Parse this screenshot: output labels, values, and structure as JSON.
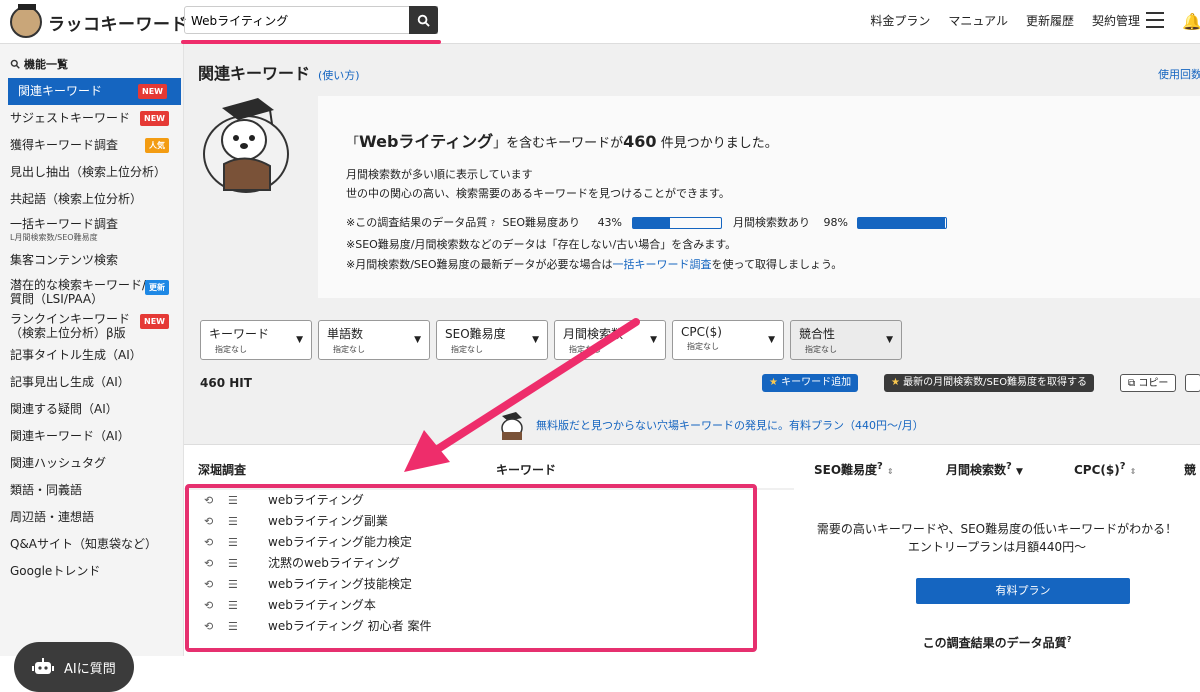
{
  "app": {
    "logo_text": "ラッコキーワード"
  },
  "search": {
    "value": "Webライティング"
  },
  "topnav": [
    "料金プラン",
    "マニュアル",
    "更新履歴",
    "契約管理"
  ],
  "sidebar": {
    "heading": "機能一覧",
    "items": [
      {
        "label": "関連キーワード",
        "badge": "NEW",
        "badge_type": "new",
        "active": true
      },
      {
        "label": "サジェストキーワード",
        "badge": "NEW",
        "badge_type": "new"
      },
      {
        "label": "獲得キーワード調査",
        "badge": "人気",
        "badge_type": "pop"
      },
      {
        "label": "見出し抽出（検索上位分析）"
      },
      {
        "label": "共起語（検索上位分析）"
      },
      {
        "label": "一括キーワード調査",
        "sub": "L月間検索数/SEO難易度"
      },
      {
        "label": "集客コンテンツ検索"
      },
      {
        "label": "潜在的な検索キーワード/",
        "label2": "質問（LSI/PAA）",
        "badge": "更新",
        "badge_type": "upd"
      },
      {
        "label": "ランクインキーワード",
        "label2": "（検索上位分析）β版",
        "badge": "NEW",
        "badge_type": "new"
      },
      {
        "label": "記事タイトル生成（AI）"
      },
      {
        "label": "記事見出し生成（AI）"
      },
      {
        "label": "関連する疑問（AI）"
      },
      {
        "label": "関連キーワード（AI）"
      },
      {
        "label": "関連ハッシュタグ"
      },
      {
        "label": "類語・同義語"
      },
      {
        "label": "周辺語・連想語"
      },
      {
        "label": "Q&Aサイト（知恵袋など）"
      },
      {
        "label": "Googleトレンド"
      }
    ],
    "ai_button": "AIに質問"
  },
  "main": {
    "title": "関連キーワード",
    "howto": "(使い方)",
    "right_link": "使用回数",
    "result_prefix": "「",
    "result_keyword": "Webライティング",
    "result_mid": "」を含むキーワードが",
    "result_count": "460",
    "result_suffix": "件見つかりました。",
    "line1": "月間検索数が多い順に表示しています",
    "line2": "世の中の関心の高い、検索需要のあるキーワードを見つけることができます。",
    "quality_label": "※この調査結果のデータ品質",
    "seo_label": "SEO難易度あり",
    "seo_pct": "43%",
    "seo_fill": 0.43,
    "vol_label": "月間検索数あり",
    "vol_pct": "98%",
    "vol_fill": 0.98,
    "note1": "※SEO難易度/月間検索数などのデータは「存在しない/古い場合」を含みます。",
    "note2_a": "※月間検索数/SEO難易度の最新データが必要な場合は",
    "note2_link": "一括キーワード調査",
    "note2_b": "を使って取得しましょう。"
  },
  "filters": [
    {
      "name": "キーワード",
      "state": "指定なし"
    },
    {
      "name": "単語数",
      "state": "指定なし"
    },
    {
      "name": "SEO難易度",
      "state": "指定なし"
    },
    {
      "name": "月間検索数",
      "state": "指定なし"
    },
    {
      "name": "CPC($)",
      "state": "指定なし"
    },
    {
      "name": "競合性",
      "state": "指定なし"
    }
  ],
  "hits": "460 HIT",
  "actions": {
    "add": "キーワード追加",
    "fetch": "最新の月間検索数/SEO難易度を取得する",
    "copy": "コピー"
  },
  "promo": "無料版だと見つからない穴場キーワードの発見に。有料プラン（440円〜/月）",
  "table": {
    "headers": {
      "deep": "深堀調査",
      "keyword": "キーワード",
      "seo": "SEO難易度",
      "volume": "月間検索数",
      "cpc": "CPC($)",
      "comp": "競"
    },
    "rows": [
      "webライティング",
      "webライティング副業",
      "webライティング能力検定",
      "沈黙のwebライティング",
      "webライティング技能検定",
      "webライティング本",
      "webライティング 初心者 案件"
    ]
  },
  "panel": {
    "line1": "需要の高いキーワードや、SEO難易度の低いキーワードがわかる！",
    "line2": "エントリープランは月額440円〜",
    "button": "有料プラン",
    "quality": "この調査結果のデータ品質"
  }
}
